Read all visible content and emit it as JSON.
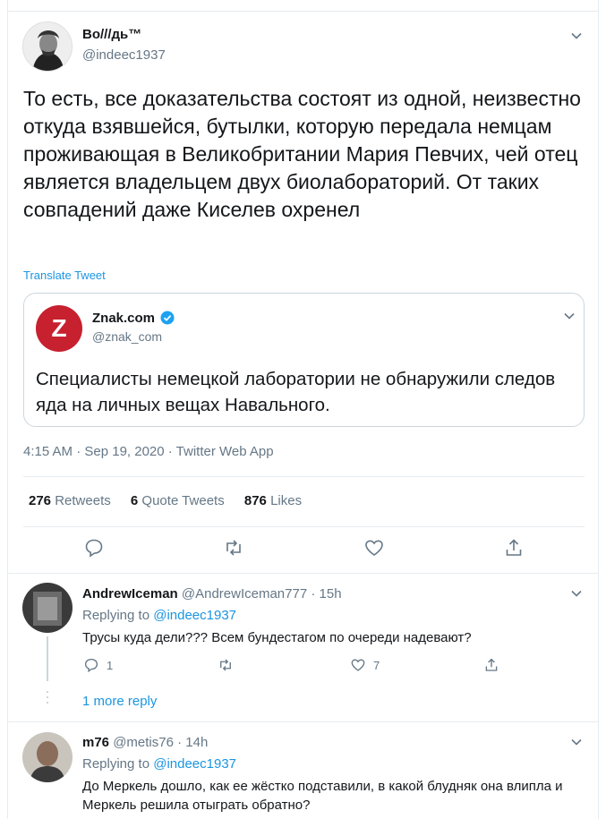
{
  "tweet": {
    "author_name": "Во///дь™",
    "author_handle": "@indeec1937",
    "text": "То есть, все доказательства состоят из одной, неизвестно откуда взявшейся, бутылки, которую передала немцам проживающая в Великобритании Мария Певчих, чей отец является владельцем двух биолабораторий. От таких совпадений даже Киселев охренел",
    "translate_label": "Translate Tweet",
    "quote": {
      "logo_letter": "Z",
      "author_name": "Znak.com",
      "author_handle": "@znak_com",
      "text": "Специалисты немецкой лаборатории не обнаружили следов яда на личных вещах Навального."
    },
    "meta": "4:15 AM · Sep 19, 2020 · Twitter Web App",
    "stats": {
      "retweets_count": "276",
      "retweets_label": "Retweets",
      "quote_count": "6",
      "quote_label": "Quote Tweets",
      "likes_count": "876",
      "likes_label": "Likes"
    },
    "actions": [
      "reply-icon",
      "retweet-icon",
      "like-icon",
      "share-icon"
    ]
  },
  "replies": [
    {
      "author_name": "AndrewIceman",
      "author_handle": "@AndrewIceman777",
      "separator": "·",
      "time": "15h",
      "replying_prefix": "Replying to",
      "replying_to": "@indeec1937",
      "text": "Трусы куда дели??? Всем бундестагом по очереди надевают?",
      "reply_count": "1",
      "retweet_count": "",
      "like_count": "7"
    },
    {
      "author_name": "m76",
      "author_handle": "@metis76",
      "separator": "·",
      "time": "14h",
      "replying_prefix": "Replying to",
      "replying_to": "@indeec1937",
      "text": "До Меркель дошло, как ее жёстко подставили, в какой блудняк она влипла и Меркель решила отыграть обратно?"
    }
  ],
  "more_replies_label": "1 more reply",
  "colors": {
    "accent": "#1b95e0",
    "secondary_text": "#657786",
    "border": "#e6ecf0",
    "znak_red": "#c7202f"
  }
}
